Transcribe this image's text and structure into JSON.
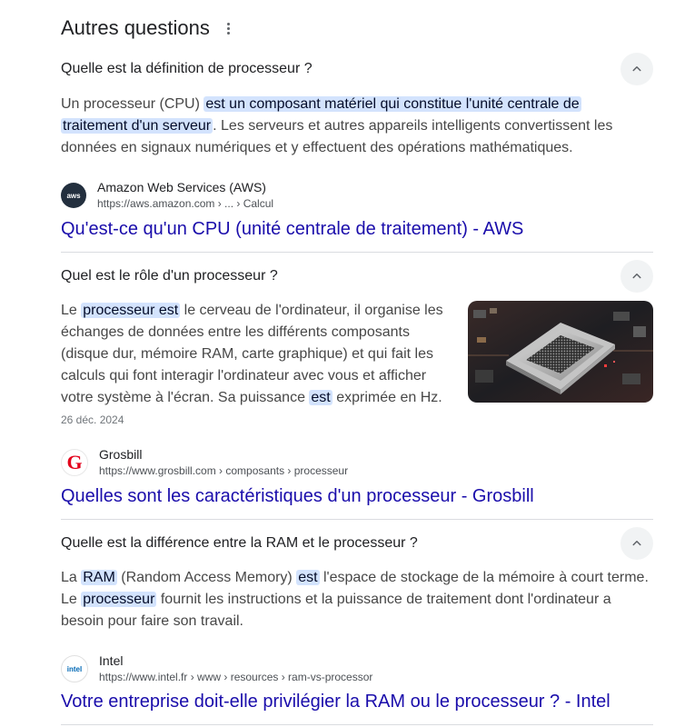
{
  "header": {
    "title": "Autres questions"
  },
  "questions": [
    {
      "question": "Quelle est la définition de processeur ?",
      "answer": {
        "t1": "Un processeur (CPU) ",
        "h1": "est un composant matériel qui constitue l'unité centrale de",
        "h2": "traitement d'un serveur",
        "t2": ". Les serveurs et autres appareils intelligents convertissent les",
        "t3": "données en signaux numériques et y effectuent des opérations mathématiques."
      },
      "source": {
        "favicon_text": "aws",
        "name": "Amazon Web Services (AWS)",
        "url": "https://aws.amazon.com › ... › Calcul"
      },
      "link": "Qu'est-ce qu'un CPU (unité centrale de traitement) - AWS"
    },
    {
      "question": "Quel est le rôle d'un processeur ?",
      "answer": {
        "t1": "Le ",
        "h1": "processeur est",
        "t2": " le cerveau de l'ordinateur, il organise les",
        "t3": "échanges de données entre les différents composants",
        "t4": "(disque dur, mémoire RAM, carte graphique) et qui fait les",
        "t5": "calculs qui font interagir l'ordinateur avec vous et afficher",
        "t6": "votre système à l'écran. Sa puissance ",
        "h2": "est",
        "t7": " exprimée en Hz."
      },
      "date": "26 déc. 2024",
      "source": {
        "favicon_text": "G",
        "name": "Grosbill",
        "url": "https://www.grosbill.com › composants › processeur"
      },
      "link": "Quelles sont les caractéristiques d'un processeur - Grosbill"
    },
    {
      "question": "Quelle est la différence entre la RAM et le processeur ?",
      "answer": {
        "t1": "La ",
        "h1": "RAM",
        "t2": " (Random Access Memory) ",
        "h2": "est",
        "t3": " l'espace de stockage de la mémoire à court terme.",
        "t4": "Le ",
        "h3": "processeur",
        "t5": " fournit les instructions et la puissance de traitement dont l'ordinateur a",
        "t6": "besoin pour faire son travail."
      },
      "source": {
        "favicon_text": "intel",
        "name": "Intel",
        "url": "https://www.intel.fr › www › resources › ram-vs-processor"
      },
      "link": "Votre entreprise doit-elle privilégier la RAM ou le processeur ? - Intel"
    }
  ]
}
